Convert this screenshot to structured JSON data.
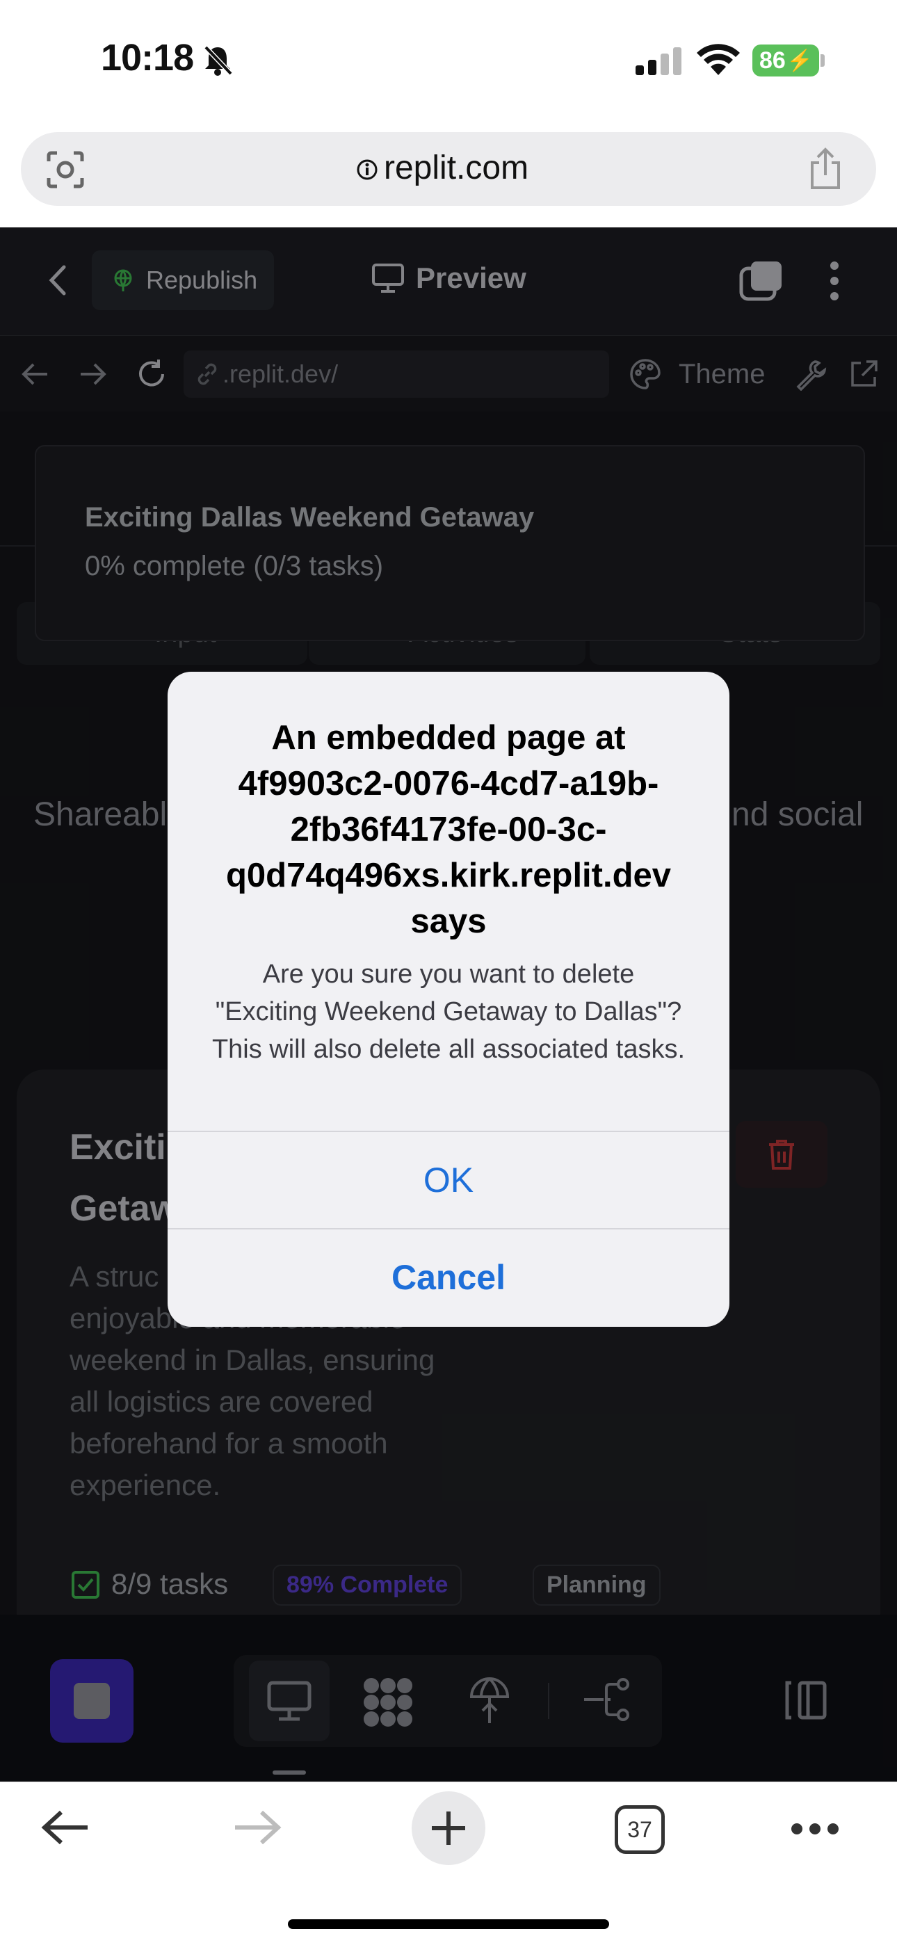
{
  "status_bar": {
    "time": "10:18",
    "battery": "86"
  },
  "browser": {
    "url": "replit.com"
  },
  "replit_header": {
    "republish": "Republish",
    "preview": "Preview"
  },
  "replit_toolbar": {
    "path": ".replit.dev/",
    "theme": "Theme"
  },
  "project_popup": {
    "title": "Exciting Dallas Weekend Getaway",
    "progress": "0% complete (0/3 tasks)"
  },
  "tabs": [
    "Input",
    "Activities",
    "Stats"
  ],
  "background": {
    "partial_left": "Shareabl",
    "partial_right": "nd social"
  },
  "card": {
    "title_line1": "Exciti",
    "title_line2": "Getaw",
    "desc_line1": "A struc",
    "desc_line2": "enjoyable and memorable",
    "desc_line3": "weekend in Dallas, ensuring",
    "desc_line4": "all logistics are covered",
    "desc_line5": "beforehand for a smooth",
    "desc_line6": "experience.",
    "tasks": "8/9 tasks",
    "complete_badge": "89% Complete",
    "status_badge": "Planning"
  },
  "dialog": {
    "title": "An embedded page at 4f9903c2-0076-4cd7-a19b-2fb36f4173fe-00-3c-q0d74q496xs.kirk.replit.dev says",
    "message": "Are you sure you want to delete \"Exciting Weekend Getaway to Dallas\"? This will also delete all associated tasks.",
    "ok": "OK",
    "cancel": "Cancel"
  },
  "safari_toolbar": {
    "tab_count": "37"
  },
  "colors": {
    "accent": "#1e6fd9",
    "purple": "#4a32c7",
    "green": "#3fb950",
    "battery": "#5ac05a"
  }
}
